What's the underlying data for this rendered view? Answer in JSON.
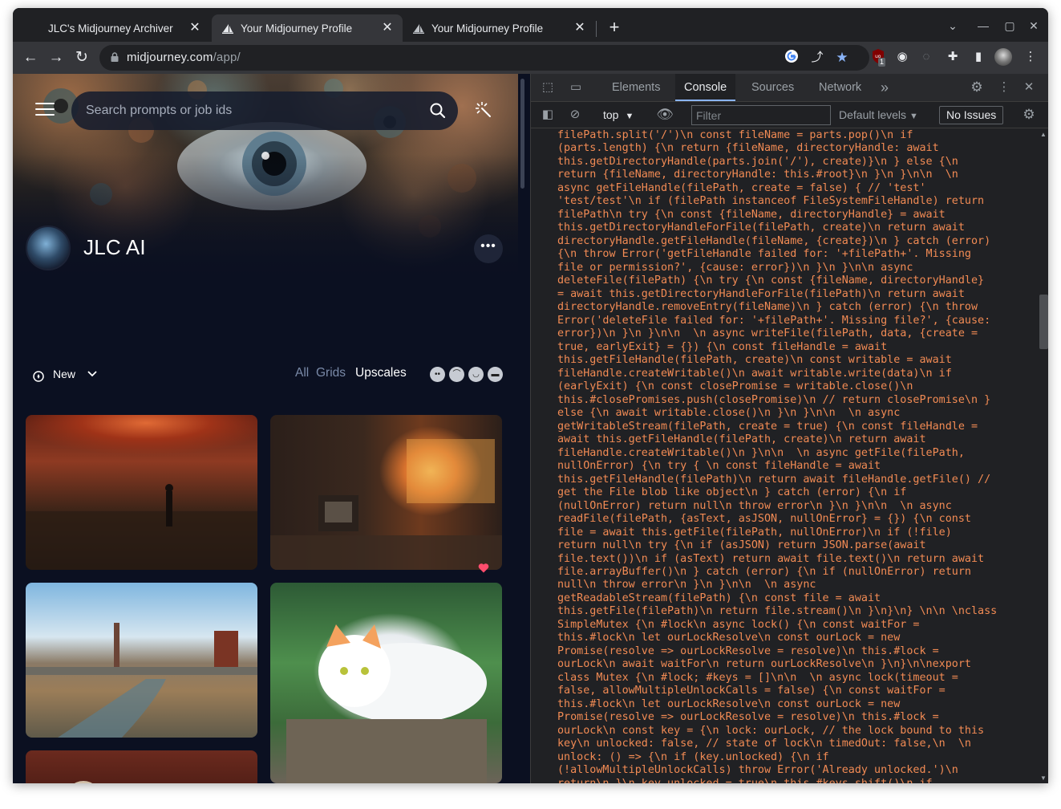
{
  "browser": {
    "tabs": [
      {
        "title": "JLC's Midjourney Archiver",
        "active": false
      },
      {
        "title": "Your Midjourney Profile",
        "active": true
      },
      {
        "title": "Your Midjourney Profile",
        "active": false
      }
    ],
    "url_host": "midjourney.com",
    "url_path": "/app/",
    "extension_badge": "1"
  },
  "page": {
    "search_placeholder": "Search prompts or job ids",
    "username": "JLC AI",
    "sort_label": "New",
    "filter_tabs": [
      "All",
      "Grids",
      "Upscales"
    ],
    "active_filter": "Upscales",
    "face_icons": [
      "face-neutral-icon",
      "face-frown-icon",
      "face-grin-icon",
      "face-sunglasses-icon"
    ],
    "accent_color": "#ff4d6d"
  },
  "devtools": {
    "tabs": [
      "Elements",
      "Console",
      "Sources",
      "Network"
    ],
    "active_tab": "Console",
    "context": "top",
    "filter_placeholder": "Filter",
    "levels": "Default levels",
    "issues": "No Issues",
    "console_color": "#f28b54",
    "console_lines": [
      "filePath.split('/')\\n const fileName = parts.pop()\\n if",
      "(parts.length) {\\n return {fileName, directoryHandle: await",
      "this.getDirectoryHandle(parts.join('/'), create)}\\n } else {\\n",
      "return {fileName, directoryHandle: this.#root}\\n }\\n }\\n\\n  \\n",
      "async getFileHandle(filePath, create = false) { // 'test'",
      "'test/test'\\n if (filePath instanceof FileSystemFileHandle) return",
      "filePath\\n try {\\n const {fileName, directoryHandle} = await",
      "this.getDirectoryHandleForFile(filePath, create)\\n return await",
      "directoryHandle.getFileHandle(fileName, {create})\\n } catch (error)",
      "{\\n throw Error('getFileHandle failed for: '+filePath+'. Missing",
      "file or permission?', {cause: error})\\n }\\n }\\n\\n async",
      "deleteFile(filePath) {\\n try {\\n const {fileName, directoryHandle}",
      "= await this.getDirectoryHandleForFile(filePath)\\n return await",
      "directoryHandle.removeEntry(fileName)\\n } catch (error) {\\n throw",
      "Error('deleteFile failed for: '+filePath+'. Missing file?', {cause:",
      "error})\\n }\\n }\\n\\n  \\n async writeFile(filePath, data, {create =",
      "true, earlyExit} = {}) {\\n const fileHandle = await",
      "this.getFileHandle(filePath, create)\\n const writable = await",
      "fileHandle.createWritable()\\n await writable.write(data)\\n if",
      "(earlyExit) {\\n const closePromise = writable.close()\\n",
      "this.#closePromises.push(closePromise)\\n // return closePromise\\n }",
      "else {\\n await writable.close()\\n }\\n }\\n\\n  \\n async",
      "getWritableStream(filePath, create = true) {\\n const fileHandle =",
      "await this.getFileHandle(filePath, create)\\n return await",
      "fileHandle.createWritable()\\n }\\n\\n  \\n async getFile(filePath,",
      "nullOnError) {\\n try { \\n const fileHandle = await",
      "this.getFileHandle(filePath)\\n return await fileHandle.getFile() //",
      "get the File blob like object\\n } catch (error) {\\n if",
      "(nullOnError) return null\\n throw error\\n }\\n }\\n\\n  \\n async",
      "readFile(filePath, {asText, asJSON, nullOnError} = {}) {\\n const",
      "file = await this.getFile(filePath, nullOnError)\\n if (!file)",
      "return null\\n try {\\n if (asJSON) return JSON.parse(await",
      "file.text())\\n if (asText) return await file.text()\\n return await",
      "file.arrayBuffer()\\n } catch (error) {\\n if (nullOnError) return",
      "null\\n throw error\\n }\\n }\\n\\n  \\n async",
      "getReadableStream(filePath) {\\n const file = await",
      "this.getFile(filePath)\\n return file.stream()\\n }\\n}\\n} \\n\\n \\nclass",
      "SimpleMutex {\\n #lock\\n async lock() {\\n const waitFor =",
      "this.#lock\\n let ourLockResolve\\n const ourLock = new",
      "Promise(resolve => ourLockResolve = resolve)\\n this.#lock =",
      "ourLock\\n await waitFor\\n return ourLockResolve\\n }\\n}\\n\\nexport",
      "class Mutex {\\n #lock; #keys = []\\n\\n  \\n async lock(timeout =",
      "false, allowMultipleUnlockCalls = false) {\\n const waitFor =",
      "this.#lock\\n let ourLockResolve\\n const ourLock = new",
      "Promise(resolve => ourLockResolve = resolve)\\n this.#lock =",
      "ourLock\\n const key = {\\n lock: ourLock, // the lock bound to this",
      "key\\n unlocked: false, // state of lock\\n timedOut: false,\\n  \\n",
      "unlock: () => {\\n if (key.unlocked) {\\n if",
      "(!allowMultipleUnlockCalls) throw Error('Already unlocked.')\\n",
      "return\\n }\\n key.unlocked = true\\n this.#keys.shift()\\n if"
    ]
  }
}
